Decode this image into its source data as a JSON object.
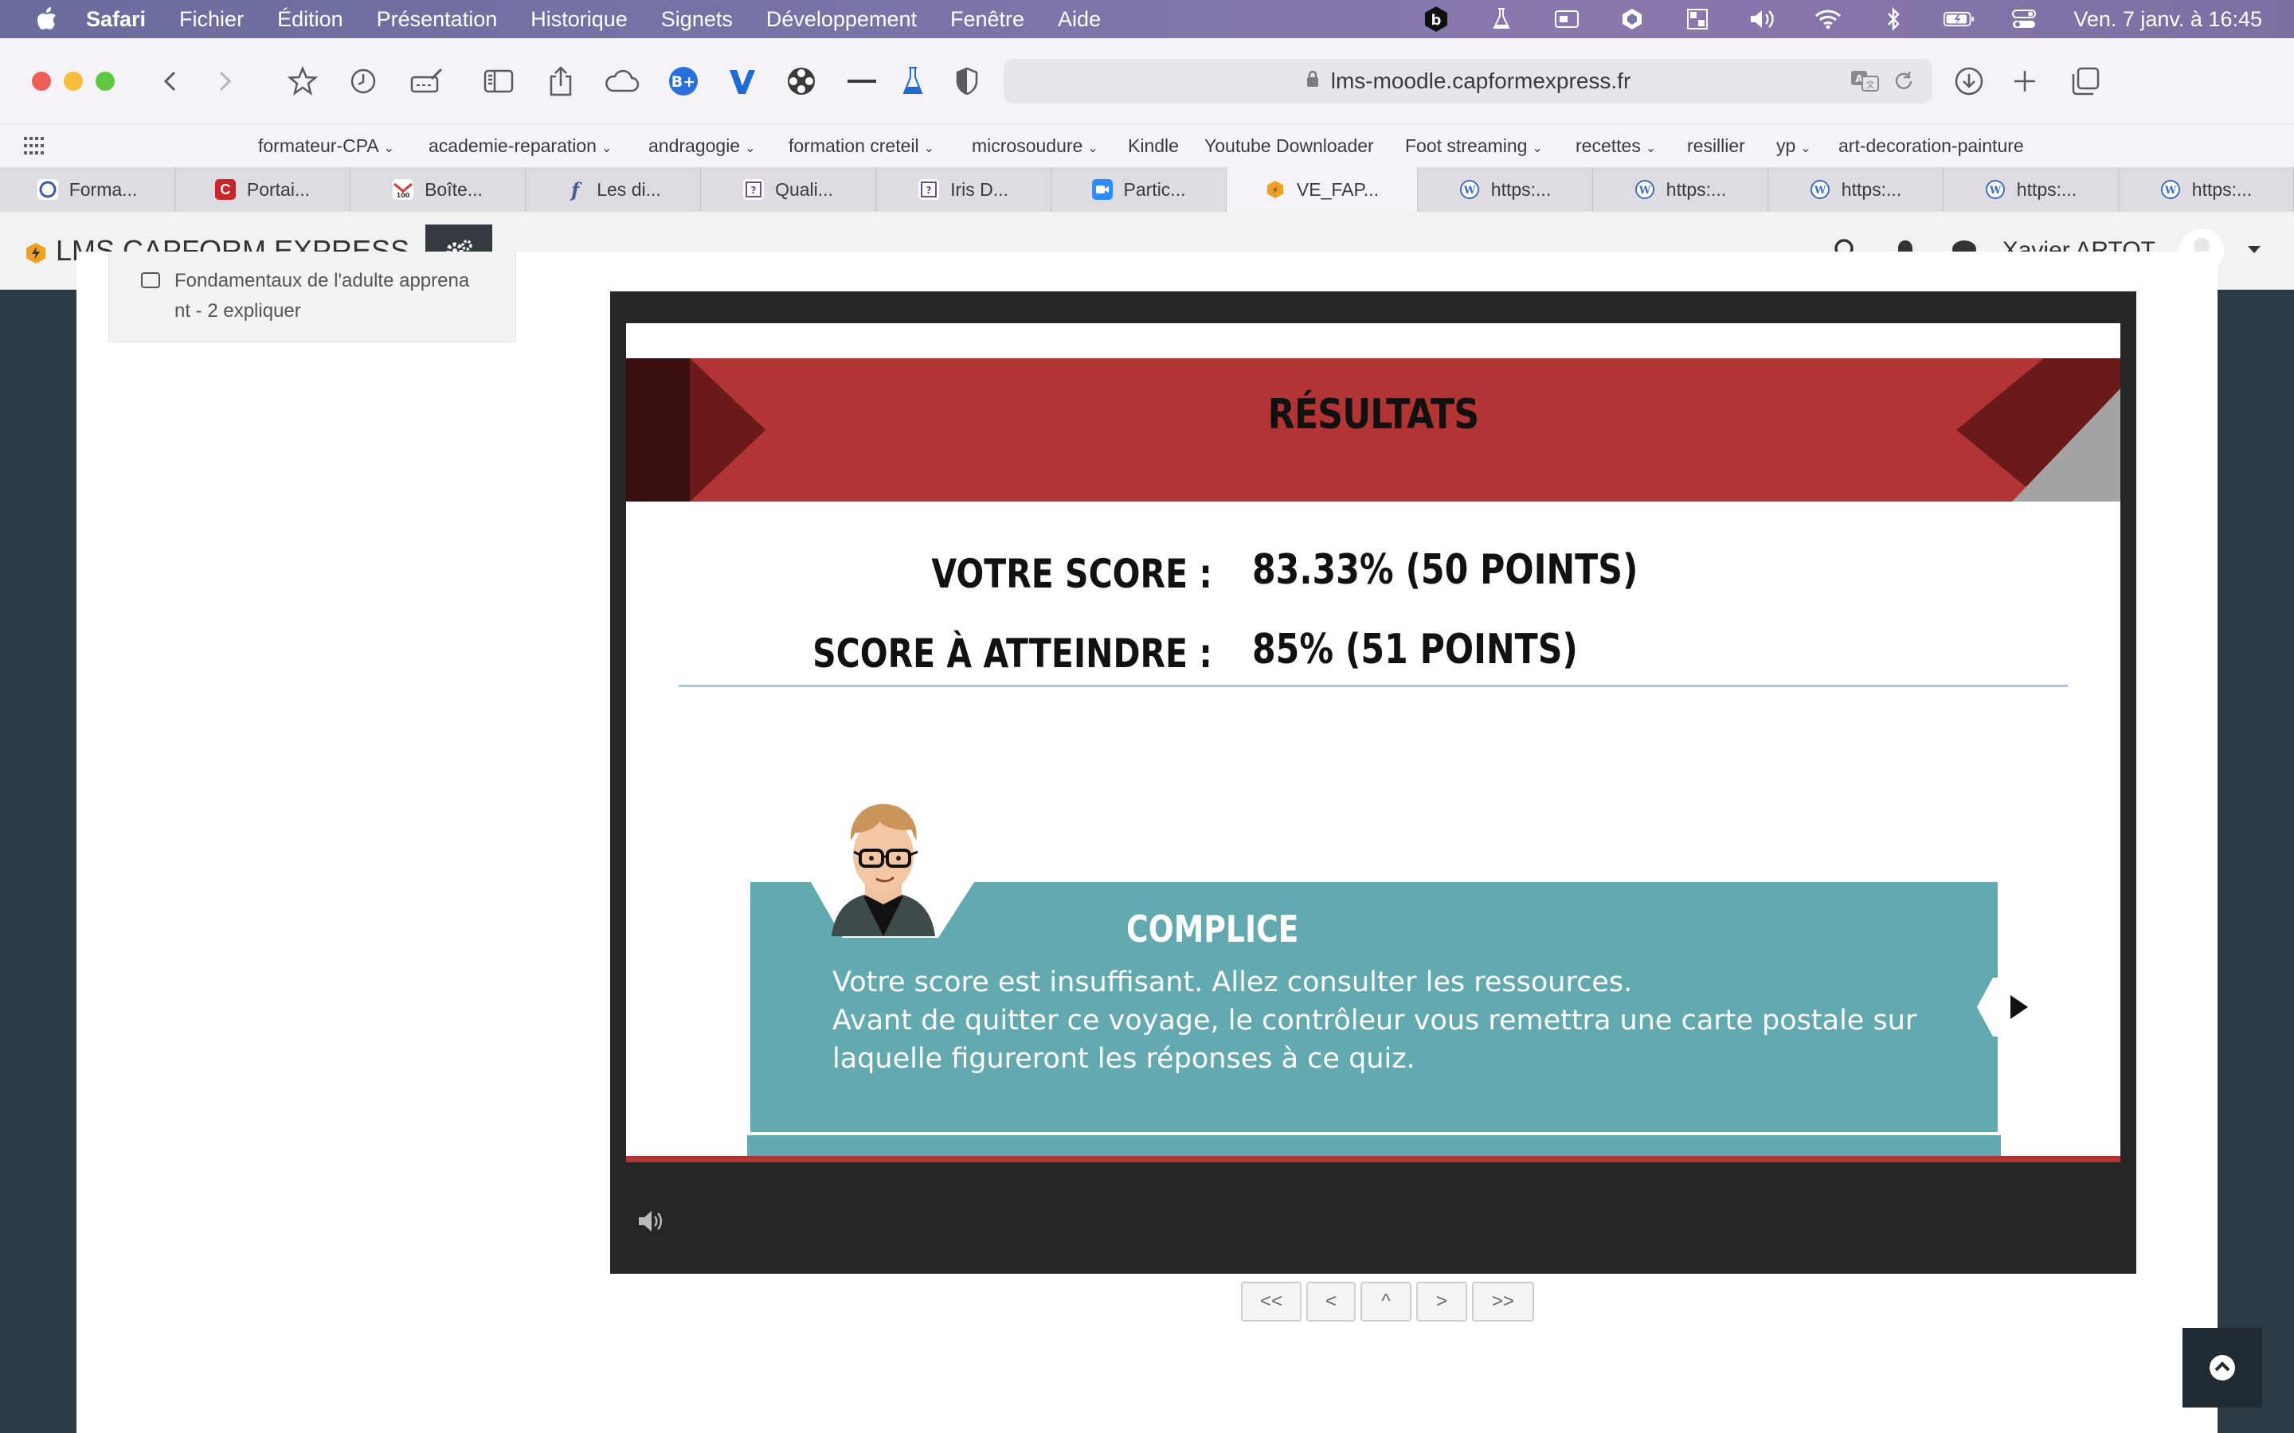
{
  "menubar": {
    "app": "Safari",
    "items": [
      "Fichier",
      "Édition",
      "Présentation",
      "Historique",
      "Signets",
      "Développement",
      "Fenêtre",
      "Aide"
    ],
    "clock": "Ven. 7 janv. à  16:45"
  },
  "browser": {
    "url": "lms-moodle.capformexpress.fr",
    "favorites": [
      {
        "label": "formateur-CPA",
        "folder": true
      },
      {
        "label": "academie-reparation",
        "folder": true
      },
      {
        "label": "andragogie",
        "folder": true
      },
      {
        "label": "formation creteil",
        "folder": true
      },
      {
        "label": "microsoudure",
        "folder": true
      },
      {
        "label": "Kindle",
        "folder": false
      },
      {
        "label": "Youtube Downloader",
        "folder": false
      },
      {
        "label": "Foot streaming",
        "folder": true
      },
      {
        "label": "recettes",
        "folder": true
      },
      {
        "label": "resillier",
        "folder": false
      },
      {
        "label": "yp",
        "folder": true
      },
      {
        "label": "art-decoration-painture",
        "folder": false
      }
    ],
    "tabs": [
      {
        "label": "Forma...",
        "icon": "circle-icon"
      },
      {
        "label": "Portai...",
        "icon": "c-icon"
      },
      {
        "label": "Boîte...",
        "icon": "mail-icon"
      },
      {
        "label": "Les di...",
        "icon": "f-icon"
      },
      {
        "label": "Quali...",
        "icon": "qualiopi-icon"
      },
      {
        "label": "Iris D...",
        "icon": "qualiopi-icon"
      },
      {
        "label": "Partic...",
        "icon": "zoom-icon"
      },
      {
        "label": "VE_FAP...",
        "icon": "moodle-icon",
        "active": true
      },
      {
        "label": "https:...",
        "icon": "wordpress-icon"
      },
      {
        "label": "https:...",
        "icon": "wordpress-icon"
      },
      {
        "label": "https:...",
        "icon": "wordpress-icon"
      },
      {
        "label": "https:...",
        "icon": "wordpress-icon"
      },
      {
        "label": "https:...",
        "icon": "wordpress-icon"
      }
    ]
  },
  "moodle": {
    "site_name": "LMS CAPFORM EXPRESS",
    "user_name": "Xavier ARTOT"
  },
  "sidebar": {
    "item_line1": "Fondamentaux de l'adulte apprena",
    "item_line2": "nt - 2 expliquer"
  },
  "slide": {
    "title": "RÉSULTATS",
    "score_label": "VOTRE SCORE :",
    "score_value": "83.33% (50 POINTS)",
    "target_label": "SCORE À ATTEINDRE :",
    "target_value": "85% (51 POINTS)",
    "feedback_title": "COMPLICE",
    "feedback_line1": "Votre score est insuffisant. Allez consulter les ressources.",
    "feedback_line2": "Avant de quitter ce voyage, le contrôleur vous remettra une carte postale sur laquelle figureront les réponses à ce quiz."
  },
  "nav": {
    "first": "<<",
    "prev": "<",
    "up": "^",
    "next": ">",
    "last": ">>"
  },
  "colors": {
    "banner_red": "#b23434",
    "feedback_teal": "#63a9b0",
    "player_dark": "#262626"
  }
}
